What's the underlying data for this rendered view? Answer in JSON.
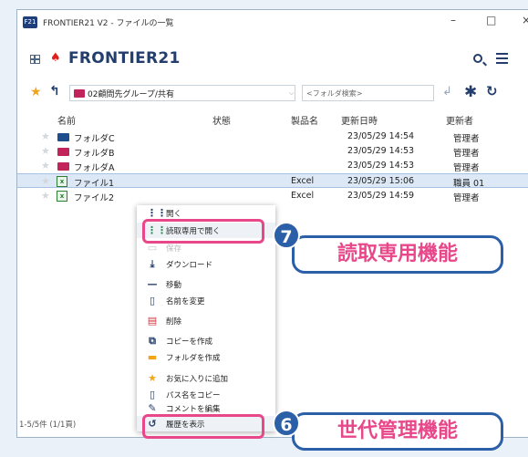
{
  "window": {
    "title": "FRONTIER21 V2 - ファイルの一覧",
    "app_icon_text": "F21",
    "minimize": "–",
    "maximize": "□",
    "close": "×"
  },
  "header": {
    "brand": "FRONTIER21"
  },
  "pathbar": {
    "path": "02顧問先グループ/共有",
    "search_placeholder": "<フォルダ検索>"
  },
  "columns": {
    "name": "名前",
    "status": "状態",
    "product": "製品名",
    "updated": "更新日時",
    "updater": "更新者"
  },
  "rows": [
    {
      "name": "フォルダC",
      "type": "folder",
      "product": "",
      "updated": "23/05/29 14:54",
      "updater": "管理者",
      "color": "#1f4e8c"
    },
    {
      "name": "フォルダB",
      "type": "folder",
      "product": "",
      "updated": "23/05/29 14:53",
      "updater": "管理者",
      "color": "#c0245a"
    },
    {
      "name": "フォルダA",
      "type": "folder",
      "product": "",
      "updated": "23/05/29 14:53",
      "updater": "管理者",
      "color": "#c0245a"
    },
    {
      "name": "ファイル1",
      "type": "excel",
      "product": "Excel",
      "updated": "23/05/29 15:06",
      "updater": "職員 01"
    },
    {
      "name": "ファイル2",
      "type": "excel",
      "product": "Excel",
      "updated": "23/05/29 14:59",
      "updater": "管理者"
    }
  ],
  "status": {
    "count": "1-5/5件 (1/1頁)"
  },
  "context_menu": [
    {
      "label": "開く",
      "icon": "grid-icon"
    },
    {
      "label": "読取専用で開く",
      "icon": "grid-icon"
    },
    {
      "label": "保存",
      "icon": "save-icon"
    },
    {
      "label": "ダウンロード",
      "icon": "download-icon"
    },
    {
      "label": "移動",
      "icon": "move-icon"
    },
    {
      "label": "名前を変更",
      "icon": "document-icon"
    },
    {
      "label": "削除",
      "icon": "trash-icon"
    },
    {
      "label": "コピーを作成",
      "icon": "copy-icon"
    },
    {
      "label": "フォルダを作成",
      "icon": "folder-icon"
    },
    {
      "label": "お気に入りに追加",
      "icon": "star-icon"
    },
    {
      "label": "パス名をコピー",
      "icon": "document-icon"
    },
    {
      "label": "コメントを編集",
      "icon": "pencil-icon"
    },
    {
      "label": "履歴を表示",
      "icon": "history-icon"
    }
  ],
  "callouts": {
    "c7_num": "7",
    "c7_text": "読取専用機能",
    "c6_num": "6",
    "c6_text": "世代管理機能"
  },
  "colors": {
    "brand": "#233e6c",
    "accent_pink": "#e8478a",
    "badge_blue": "#2b5fa8"
  }
}
